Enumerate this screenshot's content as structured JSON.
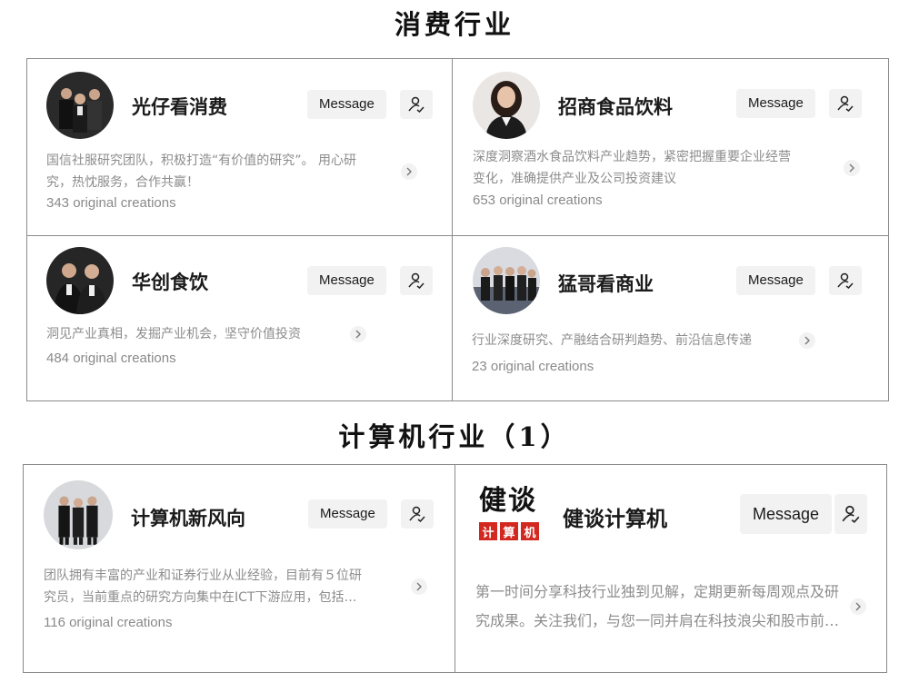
{
  "sections": [
    {
      "title": "消费行业"
    },
    {
      "title": "计算机行业（1）"
    }
  ],
  "message_label": "Message",
  "follow_icon": "user-follow-icon",
  "chevron_icon": "chevron-right-icon",
  "cards": [
    {
      "name": "光仔看消费",
      "desc_line1": "国信社服研究团队，积极打造“有价值的研究”。 用心研",
      "desc_line2": "究，热忱服务，合作共赢！",
      "count": "343 original creations"
    },
    {
      "name": "招商食品饮料",
      "desc_line1": "深度洞察酒水食品饮料产业趋势，紧密把握重要企业经营",
      "desc_line2": "变化，准确提供产业及公司投资建议",
      "count": "653 original creations"
    },
    {
      "name": "华创食饮",
      "desc_line1": "洞见产业真相，发掘产业机会，坚守价值投资",
      "count": "484 original creations"
    },
    {
      "name": "猛哥看商业",
      "desc_line1": "行业深度研究、产融结合研判趋势、前沿信息传递",
      "count": "23 original creations"
    },
    {
      "name": "计算机新风向",
      "desc_line1": "团队拥有丰富的产业和证券行业从业经验，目前有５位研",
      "desc_line2": "究员，当前重点的研究方向集中在ICT下游应用，包括…",
      "count": "116 original creations"
    },
    {
      "name": "健谈计算机",
      "logo_top": "健谈",
      "logo_bottom": [
        "计",
        "算",
        "机"
      ],
      "desc_line1": "第一时间分享科技行业独到见解，定期更新每周观点及研",
      "desc_line2": "究成果。关注我们，与您一同并肩在科技浪尖和股市前…"
    }
  ]
}
